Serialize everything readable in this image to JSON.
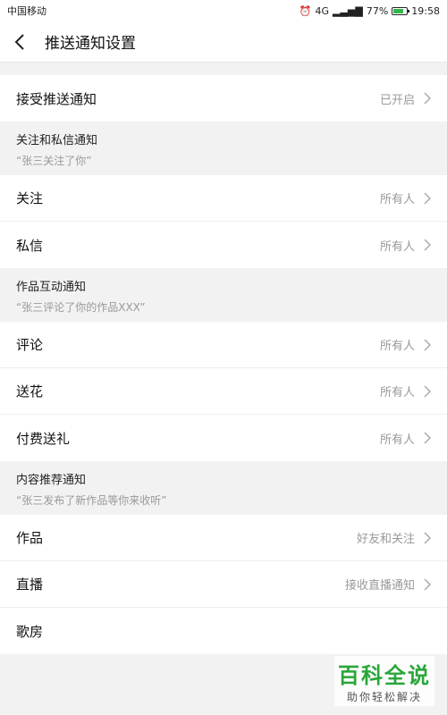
{
  "status_bar": {
    "carrier": "中国移动",
    "alarm_icon": "alarm-icon",
    "network": "4G",
    "battery": "77%",
    "time": "19:58",
    "battery_color": "#2fb84a"
  },
  "header": {
    "back_icon": "chevron-left-icon",
    "title": "推送通知设置"
  },
  "accept_row": {
    "label": "接受推送通知",
    "value": "已开启"
  },
  "sections": [
    {
      "title": "关注和私信通知",
      "subtitle": "“张三关注了你”",
      "items": [
        {
          "label": "关注",
          "value": "所有人"
        },
        {
          "label": "私信",
          "value": "所有人"
        }
      ]
    },
    {
      "title": "作品互动通知",
      "subtitle": "“张三评论了你的作品XXX”",
      "items": [
        {
          "label": "评论",
          "value": "所有人"
        },
        {
          "label": "送花",
          "value": "所有人"
        },
        {
          "label": "付费送礼",
          "value": "所有人"
        }
      ]
    },
    {
      "title": "内容推荐通知",
      "subtitle": "“张三发布了新作品等你来收听”",
      "items": [
        {
          "label": "作品",
          "value": "好友和关注"
        },
        {
          "label": "直播",
          "value": "接收直播通知"
        },
        {
          "label": "歌房",
          "value": ""
        }
      ]
    }
  ],
  "watermark": {
    "main": "百科全说",
    "sub": "助你轻松解决"
  }
}
